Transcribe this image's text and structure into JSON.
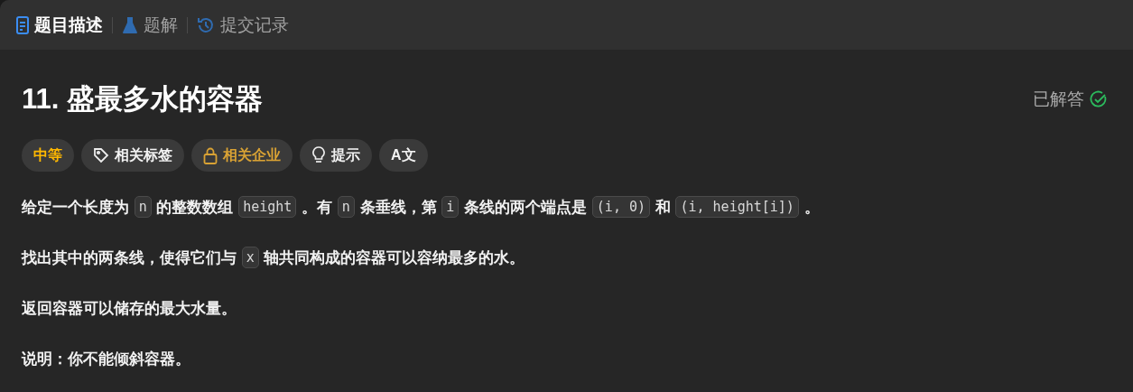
{
  "tabs": [
    {
      "label": "题目描述",
      "kind": "doc",
      "selected": true
    },
    {
      "label": "题解",
      "kind": "flask",
      "selected": false
    },
    {
      "label": "提交记录",
      "kind": "history",
      "selected": false
    }
  ],
  "title": "11. 盛最多水的容器",
  "status": {
    "label": "已解答",
    "solved": true
  },
  "tags": [
    {
      "kind": "difficulty",
      "label": "中等"
    },
    {
      "kind": "topics",
      "label": "相关标签"
    },
    {
      "kind": "companies",
      "label": "相关企业"
    },
    {
      "kind": "hint",
      "label": "提示"
    },
    {
      "kind": "translate",
      "label": "A文"
    }
  ],
  "paragraphs": [
    [
      {
        "kind": "text",
        "text": "给定一个长度为 "
      },
      {
        "kind": "code",
        "text": "n"
      },
      {
        "kind": "text",
        "text": " 的整数数组 "
      },
      {
        "kind": "code",
        "text": "height"
      },
      {
        "kind": "text",
        "text": " 。有 "
      },
      {
        "kind": "code",
        "text": "n"
      },
      {
        "kind": "text",
        "text": " 条垂线，第 "
      },
      {
        "kind": "code",
        "text": "i"
      },
      {
        "kind": "text",
        "text": " 条线的两个端点是 "
      },
      {
        "kind": "code",
        "text": "(i, 0)"
      },
      {
        "kind": "text",
        "text": " 和 "
      },
      {
        "kind": "code",
        "text": "(i, height[i])"
      },
      {
        "kind": "text",
        "text": " 。"
      }
    ],
    [
      {
        "kind": "text",
        "text": "找出其中的两条线，使得它们与 "
      },
      {
        "kind": "code",
        "text": "x"
      },
      {
        "kind": "text",
        "text": " 轴共同构成的容器可以容纳最多的水。"
      }
    ],
    [
      {
        "kind": "text",
        "text": "返回容器可以储存的最大水量。"
      }
    ],
    [
      {
        "kind": "text",
        "text": "**说明：**你不能倾斜容器。"
      }
    ]
  ]
}
